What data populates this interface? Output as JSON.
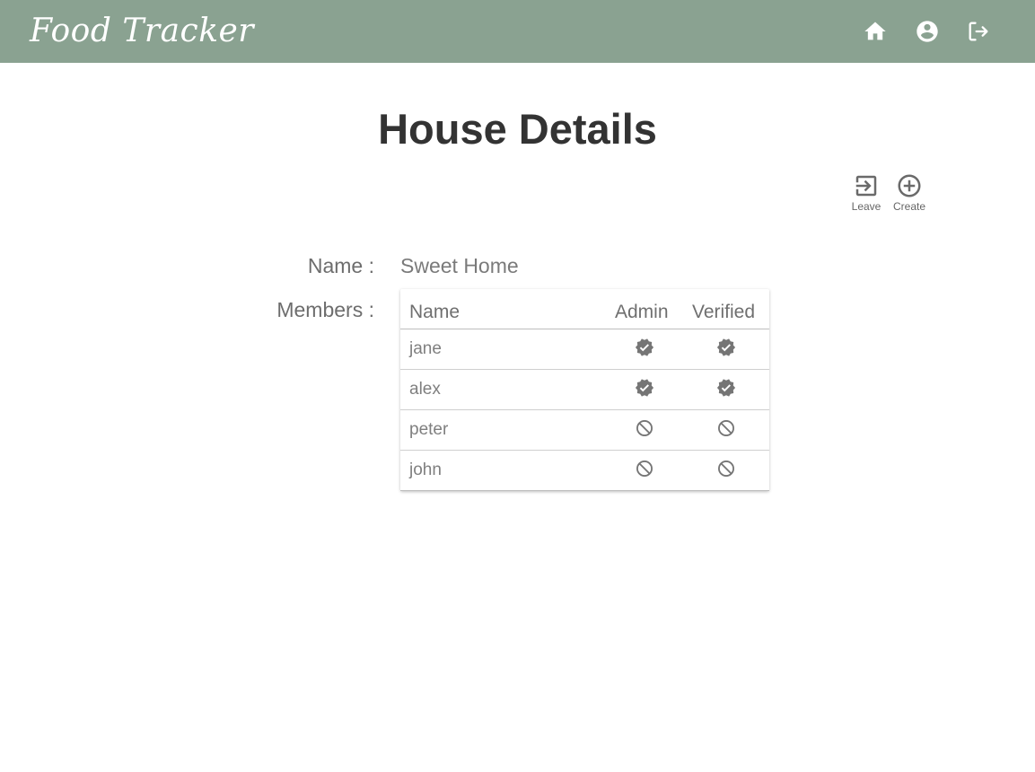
{
  "app": {
    "brand": "Food Tracker",
    "nav": [
      {
        "icon": "home-icon",
        "label": "Home"
      },
      {
        "icon": "account-circle-icon",
        "label": "Account"
      },
      {
        "icon": "logout-icon",
        "label": "Logout"
      }
    ],
    "accent_color": "#8aa291"
  },
  "page": {
    "title": "House Details"
  },
  "actions": {
    "leave_label": "Leave",
    "create_label": "Create"
  },
  "house": {
    "name_label": "Name :",
    "name_value": "Sweet Home",
    "members_label": "Members :"
  },
  "members_table": {
    "headers": [
      "Name",
      "Admin",
      "Verified"
    ],
    "rows": [
      {
        "name": "jane",
        "admin": true,
        "verified": true
      },
      {
        "name": "alex",
        "admin": true,
        "verified": true
      },
      {
        "name": "peter",
        "admin": false,
        "verified": false
      },
      {
        "name": "john",
        "admin": false,
        "verified": false
      }
    ]
  }
}
